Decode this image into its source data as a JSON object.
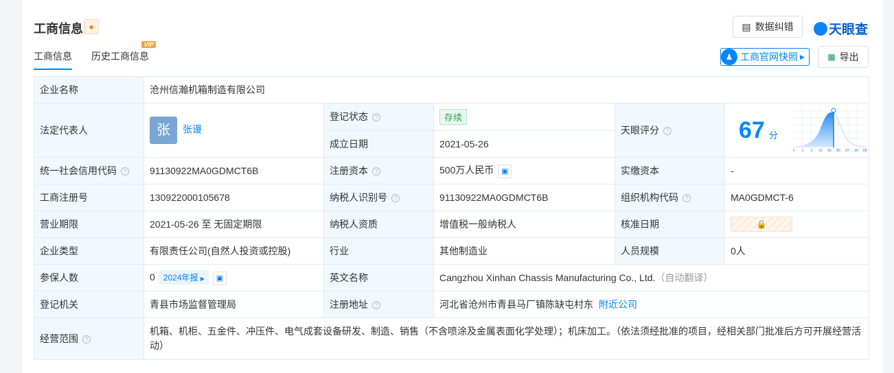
{
  "header": {
    "title": "工商信息",
    "bell_icon": "bell-icon",
    "correct_label": "数据纠错",
    "logo": "天眼查",
    "snapshot_label": "工商官网快照",
    "export_label": "导出"
  },
  "tabs": [
    {
      "label": "工商信息",
      "active": true
    },
    {
      "label": "历史工商信息",
      "badge": "VIP"
    }
  ],
  "rows": {
    "company_name": {
      "label": "企业名称",
      "value": "沧州信瀚机箱制造有限公司"
    },
    "legal_rep": {
      "label": "法定代表人",
      "avatar": "张",
      "name": "张谩"
    },
    "reg_status": {
      "label": "登记状态",
      "value": "存续"
    },
    "founded": {
      "label": "成立日期",
      "value": "2021-05-26"
    },
    "score": {
      "label": "天眼评分",
      "value": "67",
      "unit": "分",
      "ticks": [
        "0",
        "1",
        "3",
        "15",
        "50",
        "85",
        "97",
        "99",
        "100"
      ]
    },
    "credit_code": {
      "label": "统一社会信用代码",
      "value": "91130922MA0GDMCT6B"
    },
    "reg_capital": {
      "label": "注册资本",
      "value": "500万人民币"
    },
    "paid_capital": {
      "label": "实缴资本",
      "value": "-"
    },
    "reg_no": {
      "label": "工商注册号",
      "value": "130922000105678"
    },
    "taxpayer_id": {
      "label": "纳税人识别号",
      "value": "91130922MA0GDMCT6B"
    },
    "org_code": {
      "label": "组织机构代码",
      "value": "MA0GDMCT-6"
    },
    "term": {
      "label": "营业期限",
      "value": "2021-05-26 至 无固定期限"
    },
    "taxpayer_qual": {
      "label": "纳税人资质",
      "value": "增值税一般纳税人"
    },
    "approve_date": {
      "label": "核准日期"
    },
    "type": {
      "label": "企业类型",
      "value": "有限责任公司(自然人投资或控股)"
    },
    "industry": {
      "label": "行业",
      "value": "其他制造业"
    },
    "staff": {
      "label": "人员规模",
      "value": "0人"
    },
    "insured": {
      "label": "参保人数",
      "value": "0",
      "report": "2024年报"
    },
    "en_name": {
      "label": "英文名称",
      "value": "Cangzhou Xinhan Chassis Manufacturing Co., Ltd.",
      "note": "（自动翻译）"
    },
    "authority": {
      "label": "登记机关",
      "value": "青县市场监督管理局"
    },
    "address": {
      "label": "注册地址",
      "value": "河北省沧州市青县马厂镇陈缺屯村东",
      "nearby": "附近公司"
    },
    "scope": {
      "label": "经营范围",
      "value": "机箱、机柜、五金件、冲压件、电气成套设备研发、制造、销售（不含喷涂及金属表面化学处理）；机床加工。（依法须经批准的项目，经相关部门批准后方可开展经营活动）"
    }
  }
}
